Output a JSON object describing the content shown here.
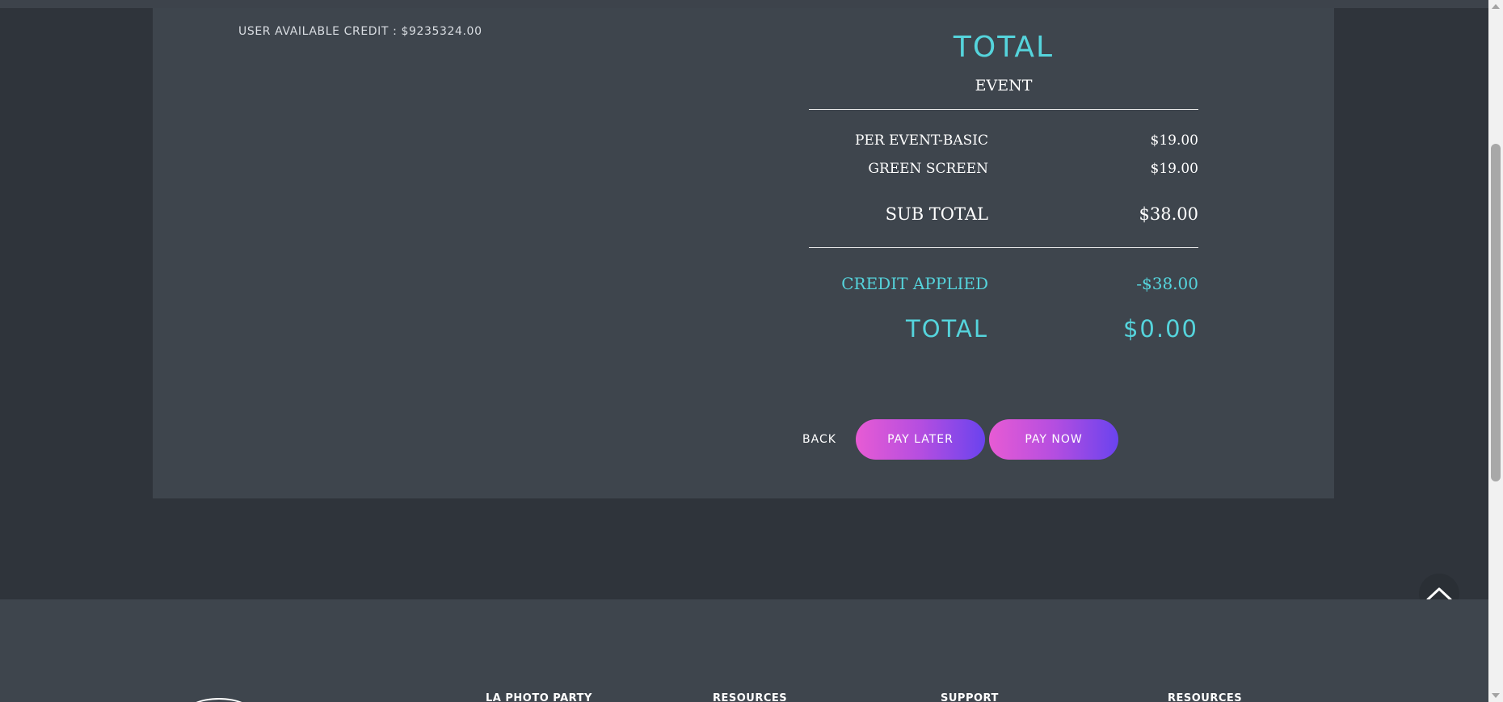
{
  "account": {
    "credit_label": "USER AVAILABLE CREDIT : $9235324.00"
  },
  "summary": {
    "title": "TOTAL",
    "subtitle": "EVENT",
    "items": [
      {
        "label": "PER EVENT-BASIC",
        "value": "$19.00"
      },
      {
        "label": "GREEN SCREEN",
        "value": "$19.00"
      }
    ],
    "subtotal_label": "SUB TOTAL",
    "subtotal_value": "$38.00",
    "credit_label": "CREDIT APPLIED",
    "credit_value": "-$38.00",
    "total_label": "TOTAL",
    "total_value": "$0.00"
  },
  "actions": {
    "back_label": "BACK",
    "pay_later_label": "PAY LATER",
    "pay_now_label": "PAY NOW"
  },
  "footer": {
    "columns": [
      "LA PHOTO PARTY",
      "RESOURCES",
      "SUPPORT",
      "RESOURCES"
    ]
  },
  "icons": {
    "scroll_top": "chevron-up-icon",
    "footer_logo": "logo-icon"
  },
  "colors": {
    "accent": "#55d4dc",
    "button_gradient_start": "#e75bd4",
    "button_gradient_end": "#6a43ee",
    "page_bg": "#2f343b",
    "card_bg": "#3e454d"
  }
}
